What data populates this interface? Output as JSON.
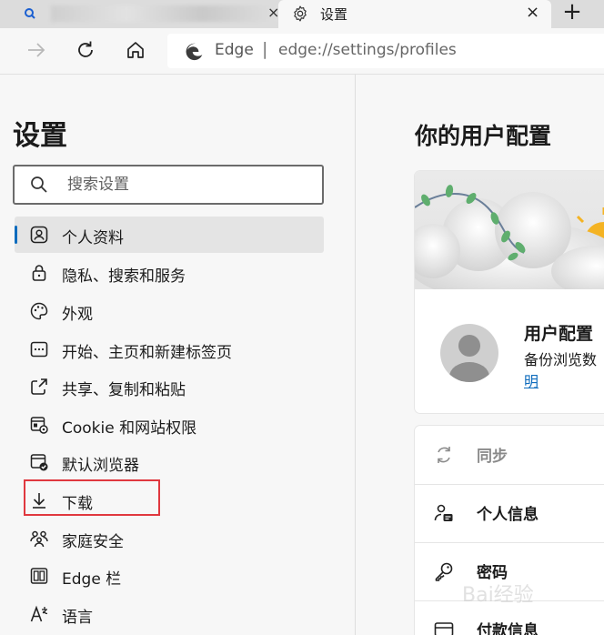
{
  "tabs": {
    "active_title": "设置"
  },
  "address_bar": {
    "brand": "Edge",
    "separator": "|",
    "url": "edge://settings/profiles"
  },
  "sidebar": {
    "title": "设置",
    "search_placeholder": "搜索设置",
    "items": [
      {
        "label": "个人资料",
        "icon": "profile-icon",
        "selected": true
      },
      {
        "label": "隐私、搜索和服务",
        "icon": "lock-icon"
      },
      {
        "label": "外观",
        "icon": "palette-icon"
      },
      {
        "label": "开始、主页和新建标签页",
        "icon": "start-page-icon"
      },
      {
        "label": "共享、复制和粘贴",
        "icon": "share-icon"
      },
      {
        "label": "Cookie 和网站权限",
        "icon": "site-permissions-icon"
      },
      {
        "label": "默认浏览器",
        "icon": "default-browser-icon"
      },
      {
        "label": "下载",
        "icon": "download-icon"
      },
      {
        "label": "家庭安全",
        "icon": "family-icon"
      },
      {
        "label": "Edge 栏",
        "icon": "edge-bar-icon"
      },
      {
        "label": "语言",
        "icon": "language-icon"
      }
    ]
  },
  "main": {
    "title": "你的用户配置",
    "profile": {
      "name": "用户配置",
      "description": "备份浏览数",
      "link": "明"
    },
    "list": [
      {
        "label": "同步",
        "icon": "sync-icon",
        "disabled": true
      },
      {
        "label": "个人信息",
        "icon": "personal-info-icon"
      },
      {
        "label": "密码",
        "icon": "key-icon"
      },
      {
        "label": "付款信息",
        "icon": "payment-icon"
      }
    ]
  },
  "watermark": "Bai经验",
  "colors": {
    "accent": "#0f6cbd",
    "highlight_box": "#e0383f"
  }
}
